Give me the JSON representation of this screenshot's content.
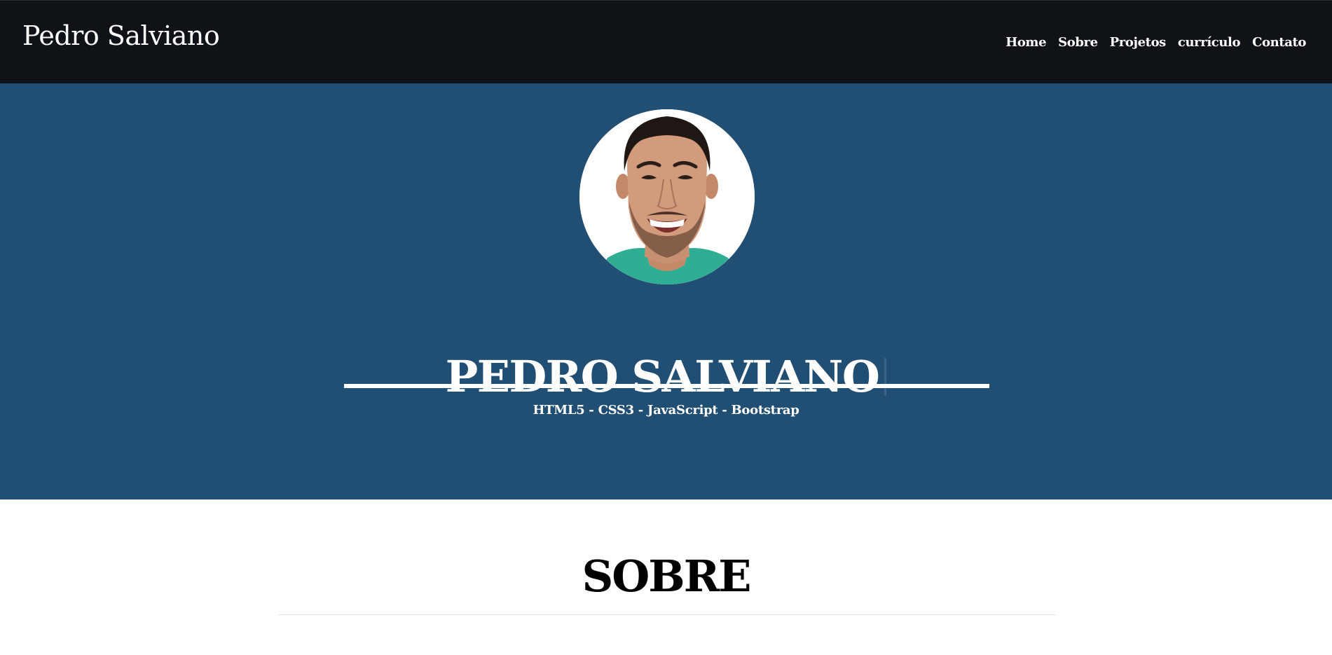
{
  "header": {
    "brand": "Pedro Salviano",
    "nav": [
      {
        "label": "Home"
      },
      {
        "label": "Sobre"
      },
      {
        "label": "Projetos"
      },
      {
        "label": "currículo"
      },
      {
        "label": "Contato"
      }
    ]
  },
  "hero": {
    "name": "PEDRO SALVIANO",
    "skills": "HTML5 - CSS3 - JavaScript - Bootstrap"
  },
  "about": {
    "title": "SOBRE"
  },
  "colors": {
    "navbar_bg": "#0f1317",
    "hero_bg": "#214e73",
    "text_light": "#ffffff",
    "text_dark": "#000000"
  }
}
